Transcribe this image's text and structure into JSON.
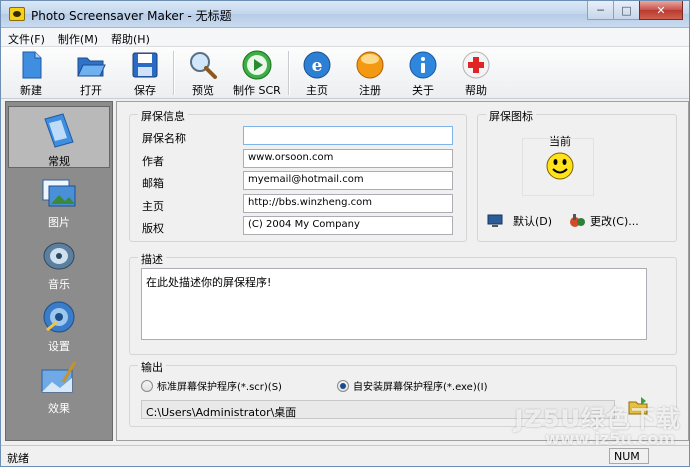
{
  "window": {
    "title": "Photo Screensaver Maker - 无标题",
    "minimize_icon": "minimize-icon",
    "maximize_icon": "maximize-icon",
    "close_icon": "close-icon"
  },
  "menu": [
    "文件(F)",
    "制作(M)",
    "帮助(H)"
  ],
  "toolbar": {
    "new": "新建",
    "open": "打开",
    "save": "保存",
    "preview": "预览",
    "make_scr": "制作 SCR",
    "home": "主页",
    "register": "注册",
    "about": "关于",
    "help": "帮助"
  },
  "nav": {
    "general": "常规",
    "images": "图片",
    "music": "音乐",
    "settings": "设置",
    "effects": "效果"
  },
  "info": {
    "group_title": "屏保信息",
    "name_label": "屏保名称",
    "name_value": "",
    "author_label": "作者",
    "author_value": "www.orsoon.com",
    "email_label": "邮箱",
    "email_value": "myemail@hotmail.com",
    "homepage_label": "主页",
    "homepage_value": "http://bbs.winzheng.com",
    "copyright_label": "版权",
    "copyright_value": "(C) 2004 My Company"
  },
  "icon_group": {
    "title": "屏保图标",
    "current_label": "当前",
    "default_button": "默认(D)",
    "change_button": "更改(C)..."
  },
  "description": {
    "title": "描述",
    "text": "在此处描述你的屏保程序!"
  },
  "output": {
    "title": "输出",
    "option_scr": "标准屏幕保护程序(*.scr)(S)",
    "option_exe": "自安装屏幕保护程序(*.exe)(I)",
    "selected": "exe",
    "path": "C:\\Users\\Administrator\\桌面"
  },
  "status": {
    "text": "就绪",
    "num": "NUM"
  },
  "watermark": {
    "brand": "JZ5U绿色下载",
    "url": "www.jz5u.com"
  }
}
